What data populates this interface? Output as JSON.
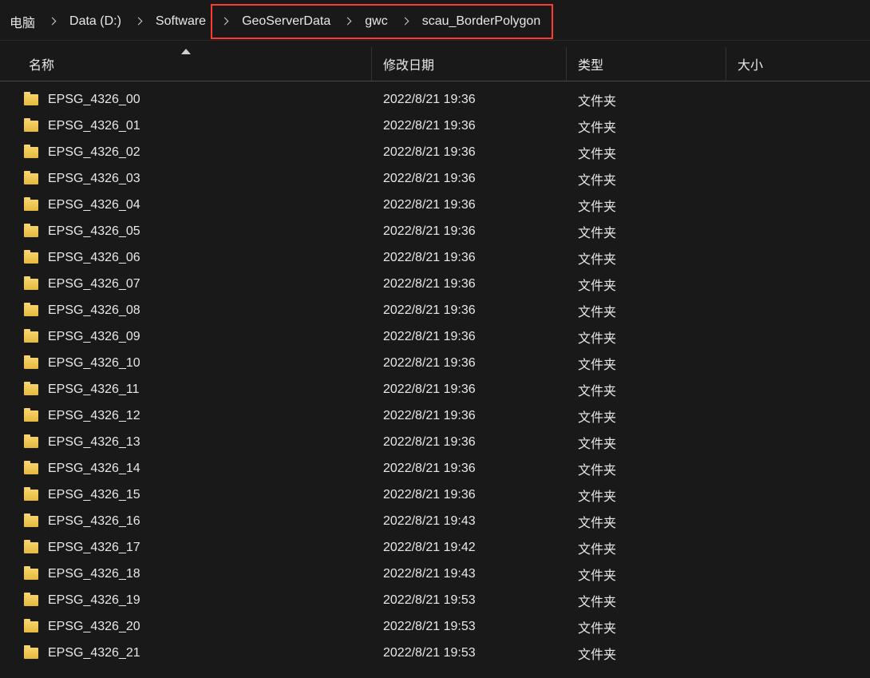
{
  "breadcrumb": {
    "items": [
      {
        "label": "电脑"
      },
      {
        "label": "Data (D:)"
      },
      {
        "label": "Software"
      },
      {
        "label": "GeoServerData"
      },
      {
        "label": "gwc"
      },
      {
        "label": "scau_BorderPolygon"
      }
    ],
    "highlight_start": 3
  },
  "columns": {
    "name": "名称",
    "date": "修改日期",
    "type": "类型",
    "size": "大小"
  },
  "rows": [
    {
      "name": "EPSG_4326_00",
      "date": "2022/8/21 19:36",
      "type": "文件夹"
    },
    {
      "name": "EPSG_4326_01",
      "date": "2022/8/21 19:36",
      "type": "文件夹"
    },
    {
      "name": "EPSG_4326_02",
      "date": "2022/8/21 19:36",
      "type": "文件夹"
    },
    {
      "name": "EPSG_4326_03",
      "date": "2022/8/21 19:36",
      "type": "文件夹"
    },
    {
      "name": "EPSG_4326_04",
      "date": "2022/8/21 19:36",
      "type": "文件夹"
    },
    {
      "name": "EPSG_4326_05",
      "date": "2022/8/21 19:36",
      "type": "文件夹"
    },
    {
      "name": "EPSG_4326_06",
      "date": "2022/8/21 19:36",
      "type": "文件夹"
    },
    {
      "name": "EPSG_4326_07",
      "date": "2022/8/21 19:36",
      "type": "文件夹"
    },
    {
      "name": "EPSG_4326_08",
      "date": "2022/8/21 19:36",
      "type": "文件夹"
    },
    {
      "name": "EPSG_4326_09",
      "date": "2022/8/21 19:36",
      "type": "文件夹"
    },
    {
      "name": "EPSG_4326_10",
      "date": "2022/8/21 19:36",
      "type": "文件夹"
    },
    {
      "name": "EPSG_4326_11",
      "date": "2022/8/21 19:36",
      "type": "文件夹"
    },
    {
      "name": "EPSG_4326_12",
      "date": "2022/8/21 19:36",
      "type": "文件夹"
    },
    {
      "name": "EPSG_4326_13",
      "date": "2022/8/21 19:36",
      "type": "文件夹"
    },
    {
      "name": "EPSG_4326_14",
      "date": "2022/8/21 19:36",
      "type": "文件夹"
    },
    {
      "name": "EPSG_4326_15",
      "date": "2022/8/21 19:36",
      "type": "文件夹"
    },
    {
      "name": "EPSG_4326_16",
      "date": "2022/8/21 19:43",
      "type": "文件夹"
    },
    {
      "name": "EPSG_4326_17",
      "date": "2022/8/21 19:42",
      "type": "文件夹"
    },
    {
      "name": "EPSG_4326_18",
      "date": "2022/8/21 19:43",
      "type": "文件夹"
    },
    {
      "name": "EPSG_4326_19",
      "date": "2022/8/21 19:53",
      "type": "文件夹"
    },
    {
      "name": "EPSG_4326_20",
      "date": "2022/8/21 19:53",
      "type": "文件夹"
    },
    {
      "name": "EPSG_4326_21",
      "date": "2022/8/21 19:53",
      "type": "文件夹"
    }
  ]
}
